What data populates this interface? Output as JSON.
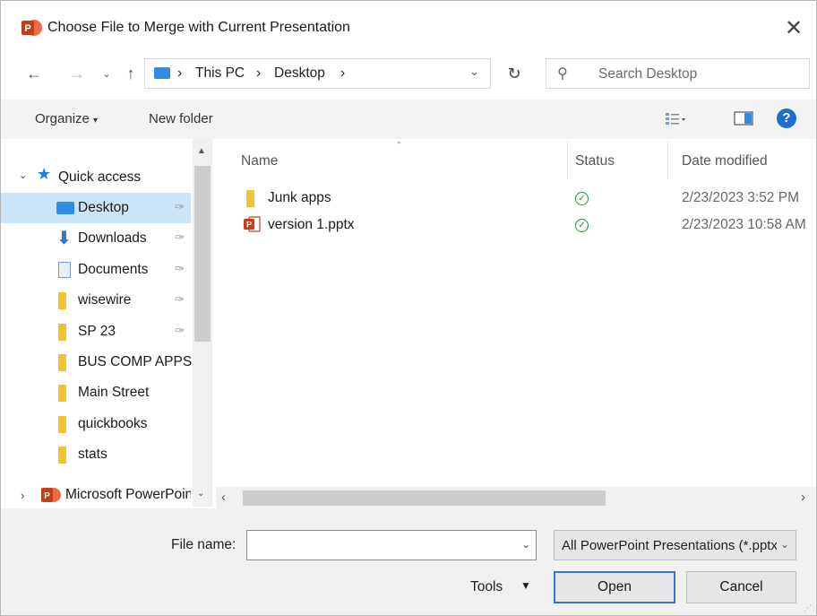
{
  "window": {
    "title": "Choose File to Merge with Current Presentation"
  },
  "nav": {
    "breadcrumb": [
      "This PC",
      "Desktop"
    ],
    "search_placeholder": "Search Desktop"
  },
  "toolbar": {
    "organize": "Organize",
    "new_folder": "New folder"
  },
  "sidebar": {
    "quick_access": "Quick access",
    "items": [
      {
        "label": "Desktop",
        "icon": "desktop-icon",
        "pinned": true,
        "selected": true
      },
      {
        "label": "Downloads",
        "icon": "download-arrow-icon",
        "pinned": true
      },
      {
        "label": "Documents",
        "icon": "documents-icon",
        "pinned": true
      },
      {
        "label": "wisewire",
        "icon": "folder-icon",
        "pinned": true
      },
      {
        "label": "SP 23",
        "icon": "folder-icon",
        "pinned": true
      },
      {
        "label": "BUS COMP APPS",
        "icon": "folder-icon",
        "pinned": false
      },
      {
        "label": "Main Street",
        "icon": "folder-icon",
        "pinned": false
      },
      {
        "label": "quickbooks",
        "icon": "folder-icon",
        "pinned": false
      },
      {
        "label": "stats",
        "icon": "folder-icon",
        "pinned": false
      }
    ],
    "powerpoint": "Microsoft PowerPoint"
  },
  "columns": {
    "name": "Name",
    "status": "Status",
    "date": "Date modified"
  },
  "files": [
    {
      "name": "Junk apps",
      "type": "folder",
      "date": "2/23/2023 3:52 PM"
    },
    {
      "name": "version 1.pptx",
      "type": "pptx",
      "date": "2/23/2023 10:58 AM"
    }
  ],
  "bottom": {
    "file_name_label": "File name:",
    "file_name_value": "",
    "filter": "All PowerPoint Presentations (*.pptx)",
    "tools": "Tools",
    "open": "Open",
    "cancel": "Cancel"
  },
  "colors": {
    "selection": "#cce4f7",
    "accent": "#2a7ad2",
    "folder": "#f2c232",
    "powerpoint": "#d24726",
    "status_ok": "#2e8b3e"
  }
}
